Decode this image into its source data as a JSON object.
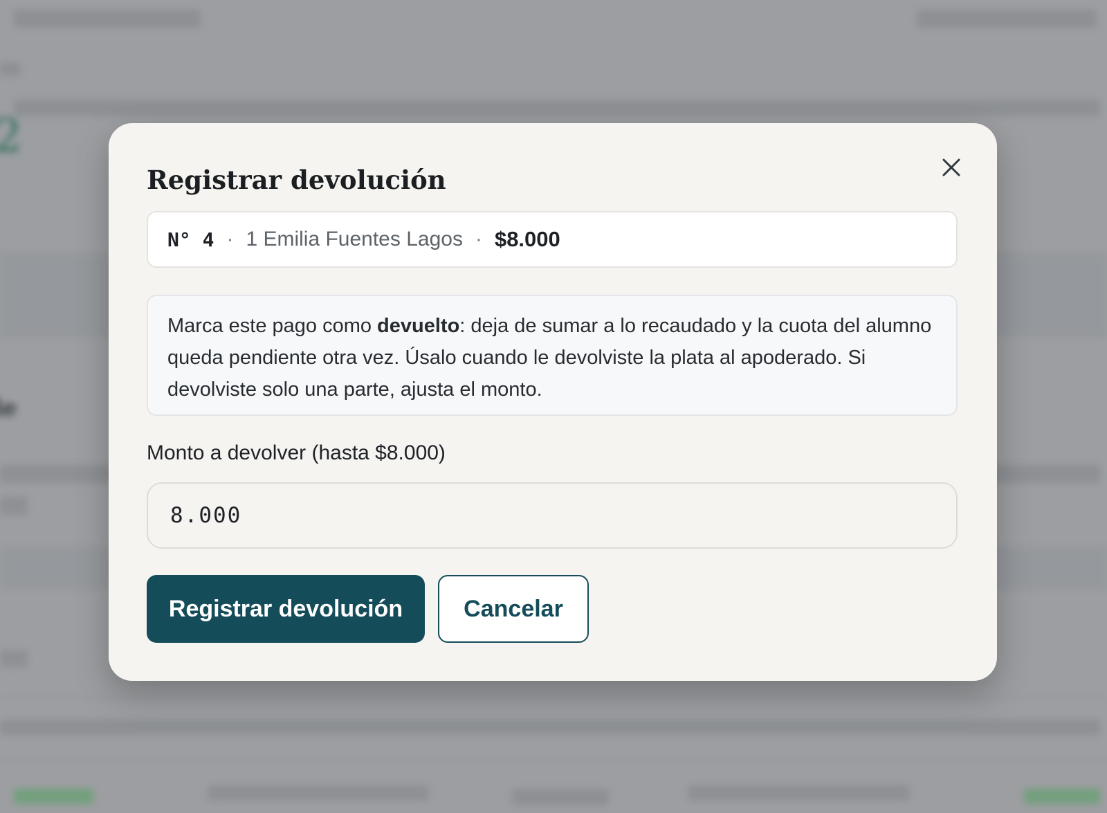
{
  "modal": {
    "title": "Registrar devolución",
    "summary": {
      "number": "N° 4",
      "separator": "·",
      "student": "1 Emilia Fuentes Lagos",
      "amount": "$8.000"
    },
    "info": {
      "text_before": "Marca este pago como ",
      "bold": "devuelto",
      "text_after": ": deja de sumar a lo recaudado y la cuota del alumno queda pendiente otra vez. Úsalo cuando le devolviste la plata al apoderado. Si devolviste solo una parte, ajusta el monto."
    },
    "amount_field": {
      "label": "Monto a devolver (hasta $8.000)",
      "value": "8.000"
    },
    "buttons": {
      "submit": "Registrar devolución",
      "cancel": "Cancelar"
    },
    "close_icon": "close-icon"
  },
  "colors": {
    "primary": "#154c5a",
    "modal_bg": "#f6f4f1",
    "overlay": "#9c9ea1"
  }
}
